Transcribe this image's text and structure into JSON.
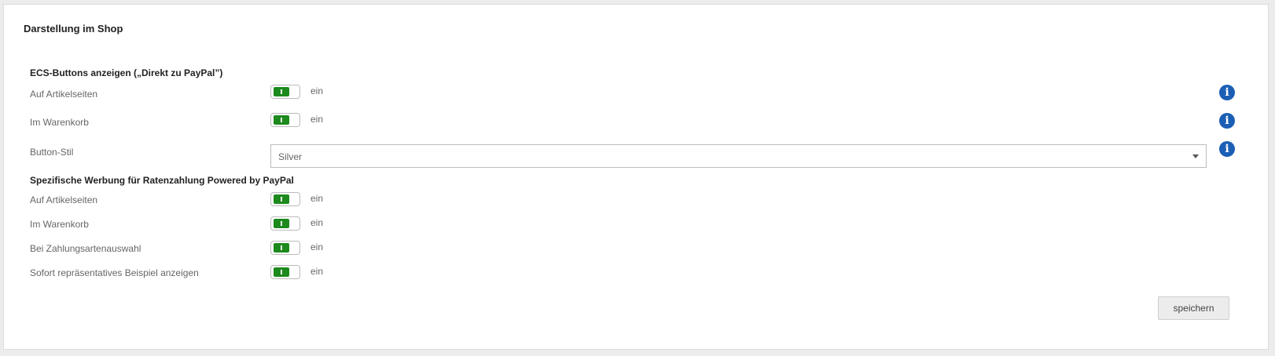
{
  "panel": {
    "title": "Darstellung im Shop"
  },
  "ecs": {
    "title": "ECS-Buttons anzeigen („Direkt zu PayPal”)",
    "rows": [
      {
        "label": "Auf Artikelseiten",
        "state": "ein",
        "on": true
      },
      {
        "label": "Im Warenkorb",
        "state": "ein",
        "on": true
      }
    ],
    "button_style": {
      "label": "Button-Stil",
      "value": "Silver"
    }
  },
  "installments": {
    "title": "Spezifische Werbung für Ratenzahlung Powered by PayPal",
    "rows": [
      {
        "label": "Auf Artikelseiten",
        "state": "ein",
        "on": true
      },
      {
        "label": "Im Warenkorb",
        "state": "ein",
        "on": true
      },
      {
        "label": "Bei Zahlungsartenauswahl",
        "state": "ein",
        "on": true
      },
      {
        "label": "Sofort repräsentatives Beispiel anzeigen",
        "state": "ein",
        "on": true
      }
    ]
  },
  "icons": {
    "info": "info-icon",
    "info_glyph": "i"
  },
  "actions": {
    "save_label": "speichern"
  },
  "colors": {
    "toggle_on": "#1c8a1c",
    "info": "#1b5fb5"
  }
}
